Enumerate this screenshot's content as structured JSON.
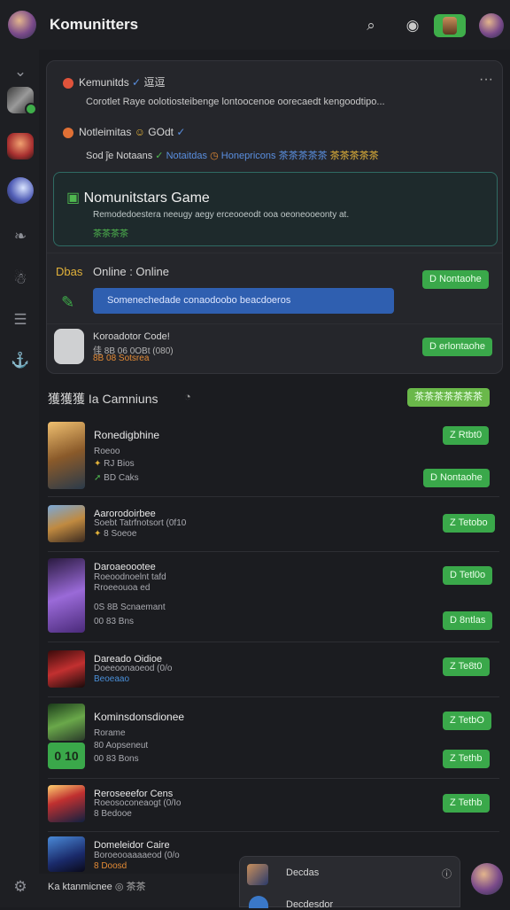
{
  "header": {
    "title": "Komunitters"
  },
  "sidebar": {
    "settings": "⚙"
  },
  "card1": {
    "row1_name": "Kemunitds",
    "row1_badge": "逗逗",
    "row1_more": "···",
    "row1_text": "Corotlet  Raye oolotiosteibenge  lontoocenoe oorecaedt kengoodtipo...",
    "row2_name": "Notleimitas",
    "row2_tag": "GOdt",
    "row2_text": "Sod  ̃je Notaans",
    "row2_links": [
      "Notaitdas",
      "Honepricons",
      "茶茶茶茶茶",
      "茶茶茶茶茶"
    ]
  },
  "feature": {
    "title": "Nomunitstars Game",
    "desc": "Remodedoestera  neeugy  aegy  erceooeodt  ooa  oeoneooeonty  at.",
    "tag": "茶茶茶茶"
  },
  "online": {
    "prefix": "Dbas",
    "status": "Online : Online",
    "button": "D Nontaohe",
    "search": "Somenechedade conaodoobo beacdoeros"
  },
  "profile": {
    "name": "Koroadotor Code!",
    "line2": "佳   8B  06 0OBt  (080)",
    "line3": "8B  08  Sotsrea",
    "button": "D erlontaohe"
  },
  "section": {
    "title": "獲獲獲 Ia Camniuns",
    "badge": "茶茶茶茶茶茶茶"
  },
  "games": [
    {
      "name": "Ronedigbhine",
      "sub1": "Roeoo",
      "sub2": "RJ  Bios",
      "sub3": "BD  Caks",
      "btn1": "Z Rtbt0",
      "btn2": "D Nontaohe"
    },
    {
      "name": "Aarorodoirbee",
      "sub1": "Soebt Tatrfnotsort (0f10",
      "sub2": "8 Soeoe",
      "btn1": "Z Tetobo"
    },
    {
      "name": "Daroaeoootee",
      "sub1": "Roeoodnoelnt tafd",
      "sub2": "Rroeeouoa  ed",
      "sub3": "0S  8B  Scnaemant",
      "sub4": "00  83  Bns",
      "btn1": "D Tetl0o",
      "btn2": "D 8ntlas"
    },
    {
      "name": "Dareado Oidioe",
      "sub1": "Doeeoonaoeod (0/o",
      "sub2": "Beoeaao",
      "btn1": "Z Te8t0"
    },
    {
      "name": "Kominsdonsdionee",
      "sub1": "Rorame",
      "sub2": "80  Aopseneut",
      "sub3": "00  83  Bons",
      "thumb_text": "0 10",
      "btn1": "Z TetbO",
      "btn2": "Z Tethb"
    },
    {
      "name": "Reroseeefor Cens",
      "sub1": "Roeosoconeaogt  (0/Io",
      "sub2": "8  Bedooe",
      "btn1": "Z Tethb"
    },
    {
      "name": "Domeleidor Caire",
      "sub1": "Boroeooaaaaeod  (0/o",
      "sub2": "8  Doosd",
      "btn1": ""
    }
  ],
  "bottom": {
    "label": "Ka  ktanmicnee",
    "suffix": "茶茶",
    "pop1": "Decdas",
    "pop2": "Decdesdor"
  }
}
